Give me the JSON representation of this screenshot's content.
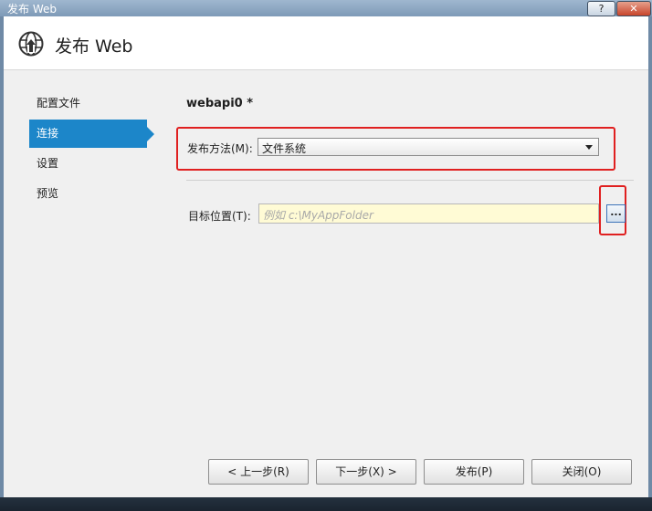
{
  "window": {
    "title": "发布 Web",
    "help_label": "?",
    "close_label": "✕"
  },
  "header": {
    "title": "发布 Web",
    "icon": "globe-publish-icon"
  },
  "nav": {
    "items": [
      {
        "label": "配置文件",
        "active": false
      },
      {
        "label": "连接",
        "active": true
      },
      {
        "label": "设置",
        "active": false
      },
      {
        "label": "预览",
        "active": false
      }
    ]
  },
  "main": {
    "profile_name": "webapi0 *",
    "publish_method_label": "发布方法(M):",
    "publish_method_value": "文件系统",
    "target_location_label": "目标位置(T):",
    "target_location_placeholder": "例如 c:\\MyAppFolder",
    "target_location_value": "",
    "browse_label": "..."
  },
  "footer": {
    "prev_label": "< 上一步(R)",
    "next_label": "下一步(X) >",
    "publish_label": "发布(P)",
    "close_label": "关闭(O)"
  },
  "colors": {
    "accent": "#1c86c9",
    "highlight_box": "#e02020",
    "input_bg": "#fffbd5"
  }
}
